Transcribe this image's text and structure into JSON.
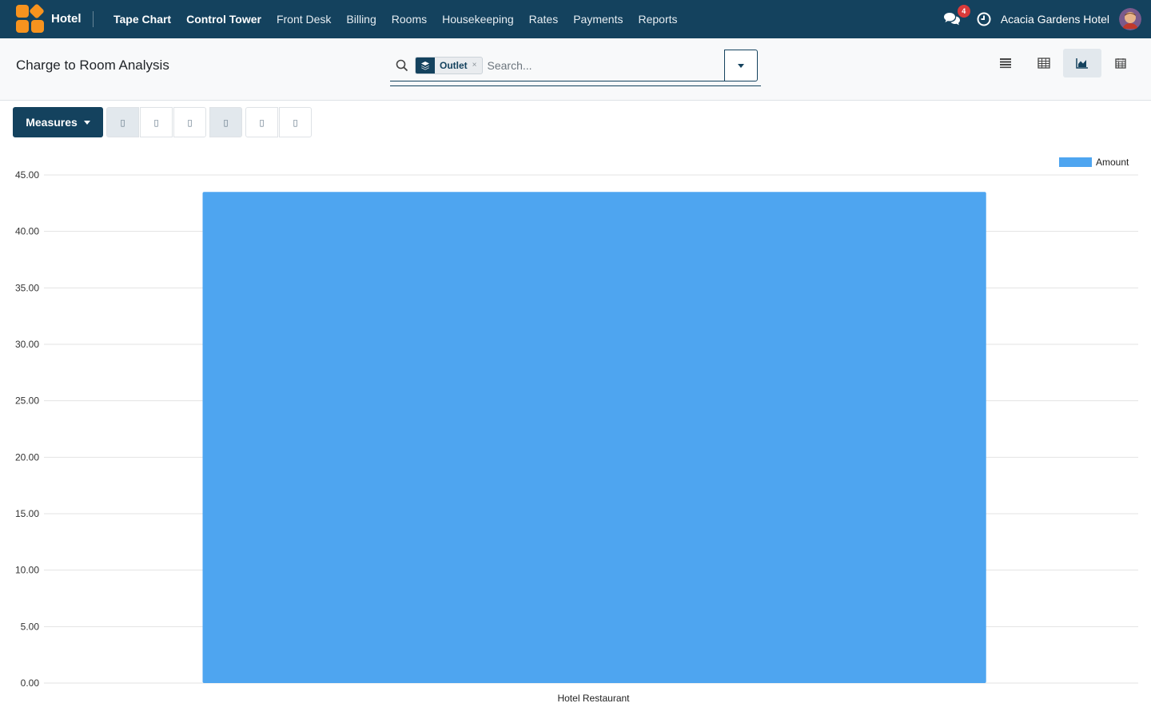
{
  "app": {
    "name": "Hotel",
    "menu": [
      "Tape Chart",
      "Control Tower",
      "Front Desk",
      "Billing",
      "Rooms",
      "Housekeeping",
      "Rates",
      "Payments",
      "Reports"
    ],
    "menu_bold": [
      true,
      true,
      false,
      false,
      false,
      false,
      false,
      false,
      false
    ],
    "chat_count": "4",
    "company": "Acacia Gardens Hotel"
  },
  "control_panel": {
    "title": "Charge to Room Analysis",
    "facet_label": "Outlet",
    "facet_close": "×",
    "search_placeholder": "Search..."
  },
  "toolbar": {
    "measures_label": "Measures",
    "group1_icons": [
      "bar-chart-icon",
      "line-chart-icon",
      "pie-chart-icon"
    ],
    "group2_icons": [
      "stacked-icon",
      "sort-descending-icon",
      "sort-ascending-icon"
    ]
  },
  "views": {
    "items": [
      "list-view-icon",
      "pivot-view-icon",
      "graph-view-icon",
      "calendar-view-icon"
    ],
    "active": "graph-view-icon"
  },
  "colors": {
    "navbar": "#14425e",
    "bar": "#4ea5f0",
    "brand": "#f7931e"
  },
  "chart_data": {
    "type": "bar",
    "categories": [
      "Hotel Restaurant"
    ],
    "series": [
      {
        "name": "Amount",
        "values": [
          43.5
        ]
      }
    ],
    "ylim": [
      0,
      45
    ],
    "yticks": [
      "0.00",
      "5.00",
      "10.00",
      "15.00",
      "20.00",
      "25.00",
      "30.00",
      "35.00",
      "40.00",
      "45.00"
    ],
    "legend": "top-right",
    "grid": true
  }
}
